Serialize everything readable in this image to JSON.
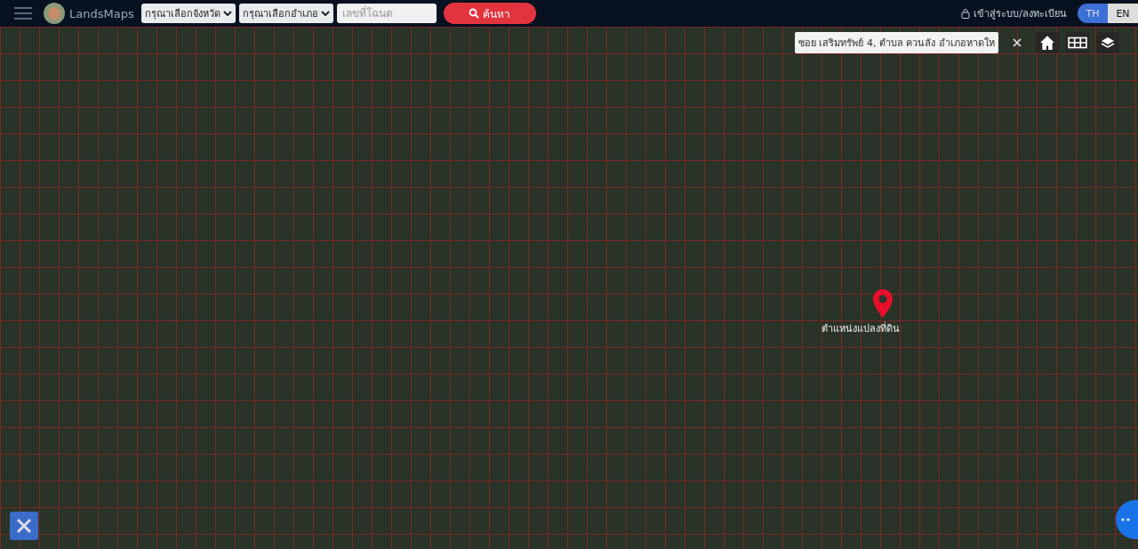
{
  "header": {
    "logo_text": "LandsMaps",
    "province_select": {
      "placeholder": "กรุณาเลือกจังหวัด"
    },
    "district_select": {
      "placeholder": "กรุณาเลือกอำเภอ"
    },
    "deed_field": {
      "placeholder": "เลขที่โฉนด"
    },
    "search_button": "ค้นหา",
    "login_link": "เข้าสู่ระบบ/ลงทะเบียน",
    "languages": [
      {
        "label": "TH",
        "selected": true
      },
      {
        "label": "EN",
        "selected": false
      }
    ]
  },
  "map": {
    "address": "ซอย เสริมทรัพย์ 4, ตำบล ควนลัง อำเภอหาดให",
    "marker_label": "ตำแหน่งแปลงที่ดิน"
  }
}
